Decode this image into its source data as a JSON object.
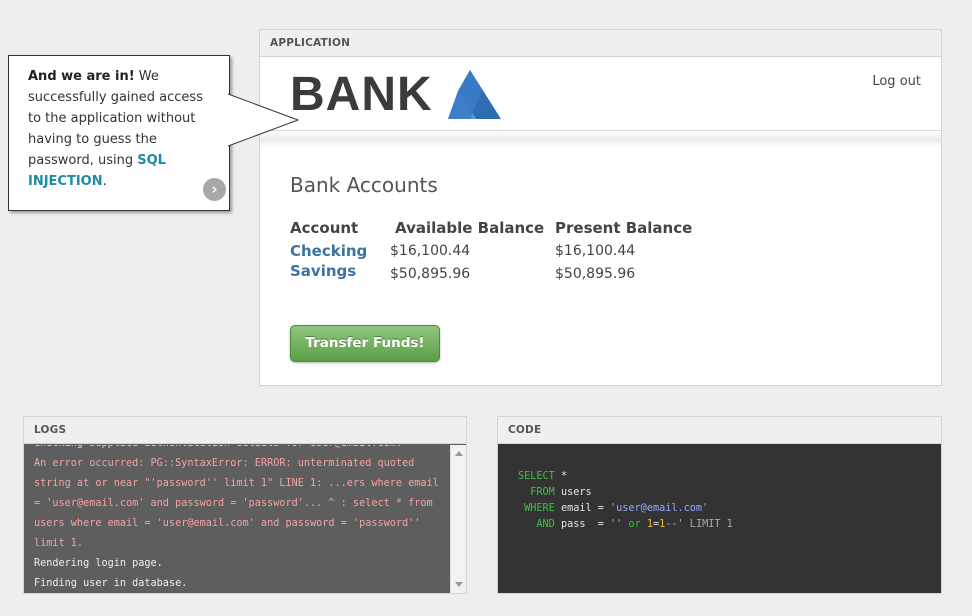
{
  "callout": {
    "bold_lead": "And we are in!",
    "text": " We successfully gained access to the application without having to guess the password, using ",
    "highlight": "SQL INJECTION",
    "end": ".",
    "next_icon": "chevron-right-icon"
  },
  "app": {
    "panel_title": "APPLICATION",
    "logo_text": "BANK",
    "logout": "Log out",
    "title": "Bank Accounts",
    "columns": [
      "Account",
      "Available Balance",
      "Present Balance"
    ],
    "accounts": [
      {
        "name": "Checking",
        "available": "$16,100.44",
        "present": "$16,100.44"
      },
      {
        "name": "Savings",
        "available": "$50,895.96",
        "present": "$50,895.96"
      }
    ],
    "transfer_button": "Transfer Funds!",
    "colors": {
      "logo_dark": "#3b3b3b",
      "logo_blue": "#3b7bc8",
      "button_green": "#6aaa55",
      "link": "#3b72a3"
    }
  },
  "logs": {
    "panel_title": "LOGS",
    "clipped_line": "Checking supplied authentication details for user@email.com.",
    "error": "An error occurred: PG::SyntaxError: ERROR: unterminated quoted string at or near \"'password'' limit 1\" LINE 1: ...ers where email = 'user@email.com' and password = 'password'... ^ : select * from users where email = 'user@email.com' and password = 'password'' limit 1.",
    "lines": [
      "Rendering login page.",
      "Finding user in database."
    ]
  },
  "code": {
    "panel_title": "CODE",
    "kw_select": "SELECT",
    "star": " *",
    "kw_from": "FROM",
    "table": " users",
    "kw_where": "WHERE",
    "email_pre": " email = ",
    "email_val": "'user@email.com'",
    "kw_and": "AND",
    "pass_pre": " pass  = ",
    "pass_q1": "''",
    "kw_or": " or ",
    "num1": "1",
    "eq": "=",
    "num2": "1",
    "tail": "--'",
    "limit": " LIMIT 1"
  }
}
